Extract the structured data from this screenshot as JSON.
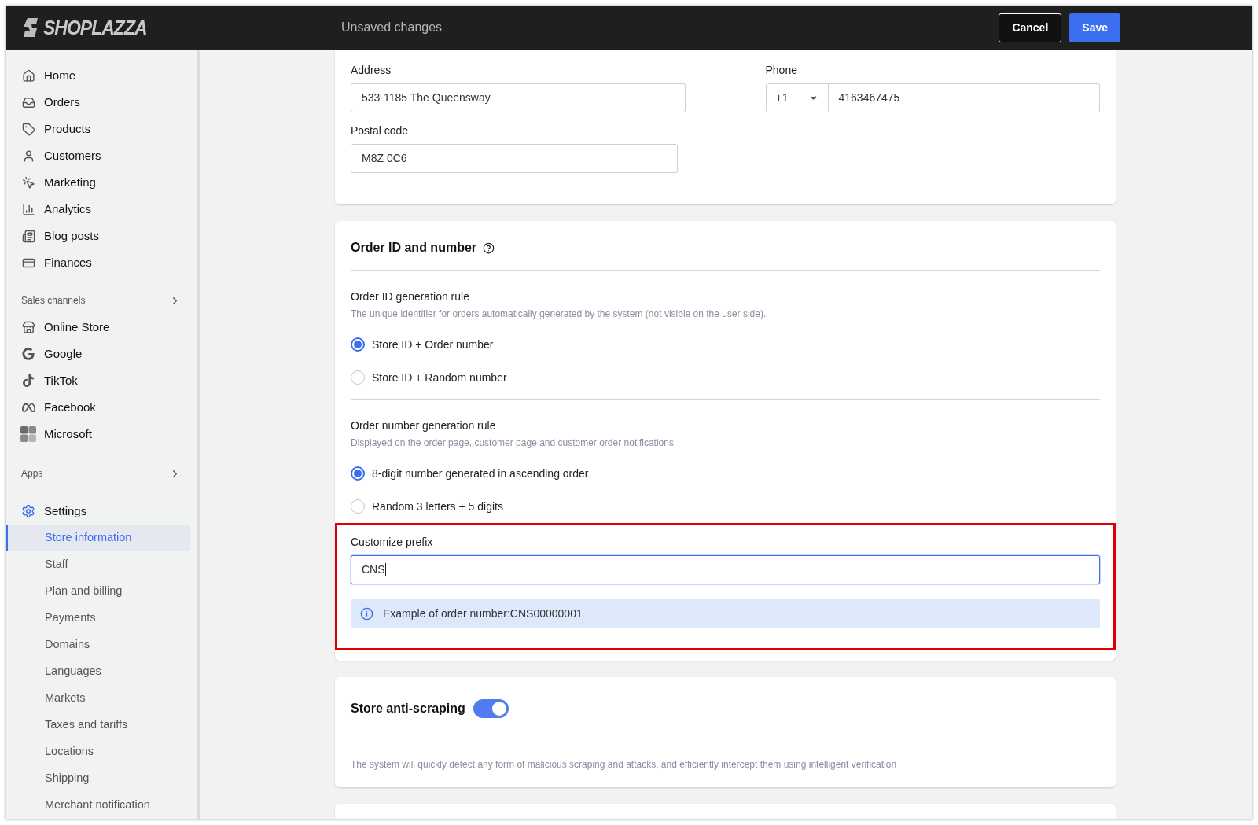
{
  "header": {
    "logo": "SHOPLAZZA",
    "title": "Unsaved changes",
    "buttons": [
      {
        "label": "Cancel",
        "kind": "secondary"
      },
      {
        "label": "Save",
        "kind": "primary"
      }
    ]
  },
  "sidebar": {
    "items": [
      {
        "label": "Home"
      },
      {
        "label": "Orders"
      },
      {
        "label": "Products"
      },
      {
        "label": "Customers"
      },
      {
        "label": "Marketing"
      },
      {
        "label": "Analytics"
      },
      {
        "label": "Blog posts"
      },
      {
        "label": "Finances"
      }
    ],
    "sales_channels": {
      "title": "Sales channels",
      "items": [
        {
          "label": "Online Store"
        },
        {
          "label": "Google"
        },
        {
          "label": "TikTok"
        },
        {
          "label": "Facebook"
        },
        {
          "label": "Microsoft"
        }
      ]
    },
    "apps": {
      "title": "Apps"
    },
    "settings": {
      "label": "Settings",
      "children": [
        {
          "label": "Store information",
          "selected": true
        },
        {
          "label": "Staff",
          "selected": false
        },
        {
          "label": "Plan and billing",
          "selected": false
        },
        {
          "label": "Payments",
          "selected": false
        },
        {
          "label": "Domains",
          "selected": false
        },
        {
          "label": "Languages",
          "selected": false
        },
        {
          "label": "Markets",
          "selected": false
        },
        {
          "label": "Taxes and tariffs",
          "selected": false
        },
        {
          "label": "Locations",
          "selected": false
        },
        {
          "label": "Shipping",
          "selected": false
        },
        {
          "label": "Merchant notification",
          "selected": false
        }
      ]
    }
  },
  "address_card": {
    "address": {
      "label": "Address",
      "value": "533-1185 The Queensway"
    },
    "phone": {
      "label": "Phone",
      "country_code": "+1",
      "value": "4163467475"
    },
    "postal_code": {
      "label": "Postal code",
      "value": "M8Z 0C6"
    }
  },
  "order_card": {
    "title": "Order ID and number",
    "rules": [
      {
        "title": "Order ID generation rule",
        "description": "The unique identifier for orders automatically generated by the system (not visible on the user side).",
        "options": [
          {
            "label": "Store ID + Order number",
            "selected": true
          },
          {
            "label": "Store ID + Random number",
            "selected": false
          }
        ]
      },
      {
        "title": "Order number generation rule",
        "description": "Displayed on the order page, customer page and customer order notifications",
        "options": [
          {
            "label": "8-digit number generated in ascending order",
            "selected": true
          },
          {
            "label": "Random 3 letters + 5 digits",
            "selected": false
          }
        ]
      }
    ],
    "prefix": {
      "label": "Customize prefix",
      "value": "CNS",
      "highlighted": true,
      "example": "Example of order number:CNS00000001"
    }
  },
  "anti_scraping": {
    "title": "Store anti-scraping",
    "on": true,
    "description": "The system will quickly detect any form of malicious scraping and attacks, and efficiently intercept them using intelligent verification"
  }
}
